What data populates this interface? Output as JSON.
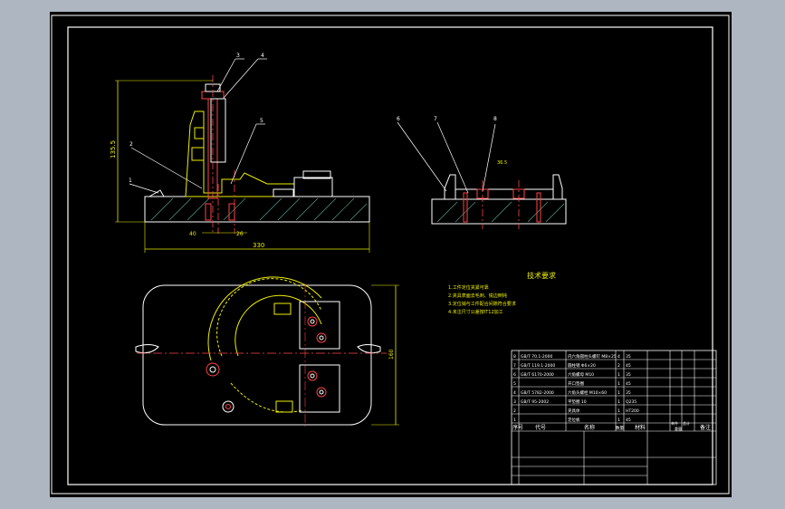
{
  "drawing": {
    "tech_title": "技术要求",
    "tech_lines": [
      "1.工件定位夹紧可靠",
      "2.夹具表面去毛刺、锐边倒钝",
      "3.定位销与工件配合间隙符合要求",
      "4.未注尺寸公差按IT12加工"
    ],
    "callouts": {
      "front": [
        "3",
        "4",
        "5",
        "2",
        "1"
      ],
      "side": [
        "6",
        "7",
        "8"
      ]
    },
    "dims": {
      "height": "135.5",
      "bottom_small": "40",
      "bottom_small2": "26",
      "overall": "330",
      "side_gap": "36.5",
      "plan_height": "160"
    },
    "title_block": {
      "rows": [
        {
          "no": "8",
          "code": "GB/T 70.1-2000",
          "name": "内六角圆柱头螺钉 M8×25",
          "qty": "4",
          "mat": "35"
        },
        {
          "no": "7",
          "code": "GB/T 119.1-2000",
          "name": "圆柱销 Φ6×20",
          "qty": "2",
          "mat": "45"
        },
        {
          "no": "6",
          "code": "GB/T 6170-2000",
          "name": "六角螺母 M10",
          "qty": "1",
          "mat": "35"
        },
        {
          "no": "5",
          "code": "",
          "name": "开口垫圈",
          "qty": "1",
          "mat": "45"
        },
        {
          "no": "4",
          "code": "GB/T 5782-2000",
          "name": "六角头螺栓 M10×60",
          "qty": "1",
          "mat": "35"
        },
        {
          "no": "3",
          "code": "GB/T 95-2002",
          "name": "平垫圈 10",
          "qty": "1",
          "mat": "Q235"
        },
        {
          "no": "2",
          "code": "",
          "name": "夹具体",
          "qty": "1",
          "mat": "HT200"
        },
        {
          "no": "1",
          "code": "",
          "name": "定位板",
          "qty": "1",
          "mat": "45"
        }
      ],
      "headers": {
        "no": "序号",
        "code": "代号",
        "name": "名称",
        "qty": "数量",
        "mat": "材料",
        "unit": "单件",
        "total": "总计",
        "weight": "重量",
        "remark": "备注"
      }
    }
  }
}
